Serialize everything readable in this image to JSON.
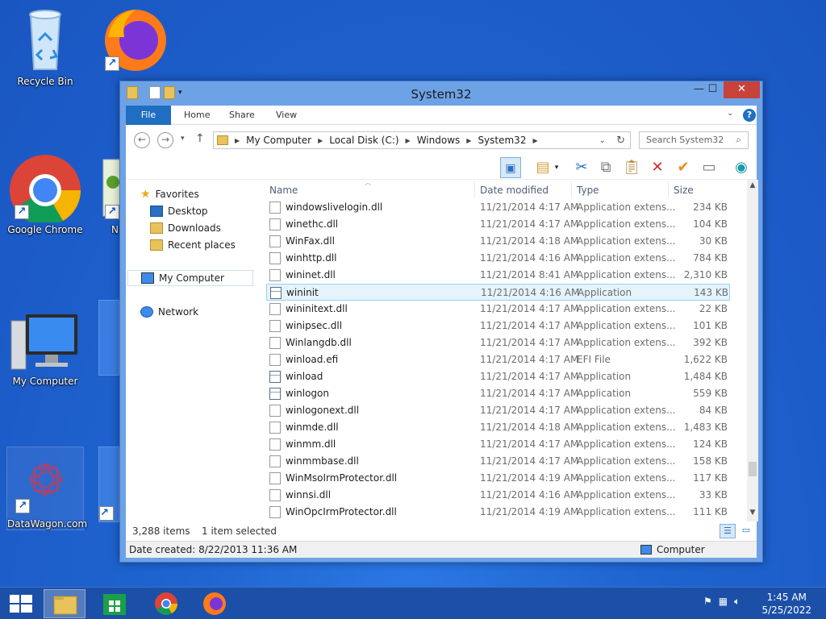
{
  "desktop": {
    "icons": [
      {
        "label": "Recycle Bin",
        "icon": "recycle-bin-icon"
      },
      {
        "label": "Google Chrome",
        "icon": "chrome-icon"
      },
      {
        "label": "My Computer",
        "icon": "computer-icon"
      },
      {
        "label": "DataWagon.com",
        "icon": "datawagon-icon"
      },
      {
        "label": "N",
        "icon": "notepad-icon"
      }
    ]
  },
  "window": {
    "title": "System32",
    "ribbon_tabs": [
      "File",
      "Home",
      "Share",
      "View"
    ],
    "address": {
      "segments": [
        "My Computer",
        "Local Disk (C:)",
        "Windows",
        "System32"
      ]
    },
    "search": {
      "placeholder": "Search System32"
    },
    "nav": {
      "favorites_label": "Favorites",
      "favorites": [
        "Desktop",
        "Downloads",
        "Recent places"
      ],
      "my_computer": "My Computer",
      "network": "Network"
    },
    "columns": [
      "Name",
      "Date modified",
      "Type",
      "Size"
    ],
    "files": [
      {
        "name": "windowslivelogin.dll",
        "date": "11/21/2014 4:17 AM",
        "type": "Application extens...",
        "size": "234 KB",
        "kind": "dll"
      },
      {
        "name": "winethc.dll",
        "date": "11/21/2014 4:17 AM",
        "type": "Application extens...",
        "size": "104 KB",
        "kind": "dll"
      },
      {
        "name": "WinFax.dll",
        "date": "11/21/2014 4:18 AM",
        "type": "Application extens...",
        "size": "30 KB",
        "kind": "dll"
      },
      {
        "name": "winhttp.dll",
        "date": "11/21/2014 4:16 AM",
        "type": "Application extens...",
        "size": "784 KB",
        "kind": "dll"
      },
      {
        "name": "wininet.dll",
        "date": "11/21/2014 8:41 AM",
        "type": "Application extens...",
        "size": "2,310 KB",
        "kind": "dll"
      },
      {
        "name": "wininit",
        "date": "11/21/2014 4:16 AM",
        "type": "Application",
        "size": "143 KB",
        "kind": "app",
        "selected": true
      },
      {
        "name": "wininitext.dll",
        "date": "11/21/2014 4:17 AM",
        "type": "Application extens...",
        "size": "22 KB",
        "kind": "dll"
      },
      {
        "name": "winipsec.dll",
        "date": "11/21/2014 4:17 AM",
        "type": "Application extens...",
        "size": "101 KB",
        "kind": "dll"
      },
      {
        "name": "Winlangdb.dll",
        "date": "11/21/2014 4:17 AM",
        "type": "Application extens...",
        "size": "392 KB",
        "kind": "dll"
      },
      {
        "name": "winload.efi",
        "date": "11/21/2014 4:17 AM",
        "type": "EFI File",
        "size": "1,622 KB",
        "kind": "file"
      },
      {
        "name": "winload",
        "date": "11/21/2014 4:17 AM",
        "type": "Application",
        "size": "1,484 KB",
        "kind": "app"
      },
      {
        "name": "winlogon",
        "date": "11/21/2014 4:17 AM",
        "type": "Application",
        "size": "559 KB",
        "kind": "app"
      },
      {
        "name": "winlogonext.dll",
        "date": "11/21/2014 4:17 AM",
        "type": "Application extens...",
        "size": "84 KB",
        "kind": "dll"
      },
      {
        "name": "winmde.dll",
        "date": "11/21/2014 4:18 AM",
        "type": "Application extens...",
        "size": "1,483 KB",
        "kind": "dll"
      },
      {
        "name": "winmm.dll",
        "date": "11/21/2014 4:17 AM",
        "type": "Application extens...",
        "size": "124 KB",
        "kind": "dll"
      },
      {
        "name": "winmmbase.dll",
        "date": "11/21/2014 4:17 AM",
        "type": "Application extens...",
        "size": "158 KB",
        "kind": "dll"
      },
      {
        "name": "WinMsoIrmProtector.dll",
        "date": "11/21/2014 4:19 AM",
        "type": "Application extens...",
        "size": "117 KB",
        "kind": "dll"
      },
      {
        "name": "winnsi.dll",
        "date": "11/21/2014 4:16 AM",
        "type": "Application extens...",
        "size": "33 KB",
        "kind": "dll"
      },
      {
        "name": "WinOpcIrmProtector.dll",
        "date": "11/21/2014 4:19 AM",
        "type": "Application extens...",
        "size": "111 KB",
        "kind": "dll"
      }
    ],
    "status": {
      "items": "3,288 items",
      "selected": "1 item selected"
    },
    "details": {
      "created": "Date created: 8/22/2013 11:36 AM",
      "location": "Computer"
    }
  },
  "taskbar": {
    "time": "1:45 AM",
    "date": "5/25/2022"
  },
  "colors": {
    "accent": "#1f6ec2",
    "selection": "#e5f3fb",
    "close": "#c7423a"
  }
}
